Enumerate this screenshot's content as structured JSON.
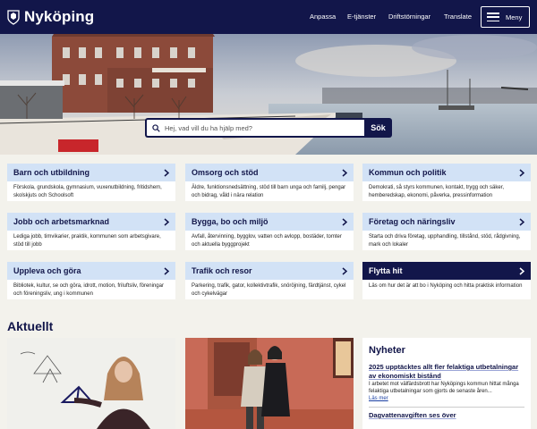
{
  "header": {
    "logo_text": "Nyköping",
    "nav": [
      "Anpassa",
      "E-tjänster",
      "Driftstörningar",
      "Translate"
    ],
    "menu_label": "Meny"
  },
  "search": {
    "placeholder": "Hej, vad vill du ha hjälp med?",
    "button_label": "Sök"
  },
  "cards": [
    {
      "title": "Barn och utbildning",
      "desc": "Förskola, grundskola, gymnasium, vuxenutbildning, fritidshem, skolskjuts och Schoolsoft"
    },
    {
      "title": "Omsorg och stöd",
      "desc": "Äldre, funktionsnedsättning, stöd till barn unga och familj, pengar och bidrag, våld i nära relation"
    },
    {
      "title": "Kommun och politik",
      "desc": "Demokrati, så styrs kommunen, kontakt, trygg och säker, hemberedskap, ekonomi, påverka, pressinformation"
    },
    {
      "title": "Jobb och arbetsmarknad",
      "desc": "Lediga jobb, timvikarier, praktik, kommunen som arbetsgivare, stöd till jobb"
    },
    {
      "title": "Bygga, bo och miljö",
      "desc": "Avfall, återvinning, bygglov, vatten och avlopp, bostäder, tomter och aktuella byggprojekt"
    },
    {
      "title": "Företag och näringsliv",
      "desc": "Starta och driva företag, upphandling, tillstånd, stöd, rådgivning, mark och lokaler"
    },
    {
      "title": "Uppleva och göra",
      "desc": "Bibliotek, kultur, se och göra, idrott, motion, friluftsliv, föreningar och föreningsliv, ung i kommunen"
    },
    {
      "title": "Trafik och resor",
      "desc": "Parkering, trafik, gator, kollektivtrafik, snöröjning, färdtjänst, cykel och cykelvägar"
    },
    {
      "title": "Flytta hit",
      "desc": "Läs om hur det är att bo i Nyköping och hitta praktisk information"
    }
  ],
  "aktuellt": {
    "title": "Aktuellt"
  },
  "news": {
    "heading": "Nyheter",
    "items": [
      {
        "title": "2025 upptäcktes allt fler felaktiga utbetalningar av ekonomiskt bistånd",
        "text": "I arbetet mot välfärdsbrott har Nyköpings kommun hittat många felaktiga utbetalningar som gjorts de senaste åren...",
        "more": "Läs mer"
      },
      {
        "title": "Dagvattenavgiften ses över"
      }
    ]
  },
  "colors": {
    "navy": "#12164a",
    "card_head": "#d2e2f6",
    "background": "#f3f2ec"
  }
}
